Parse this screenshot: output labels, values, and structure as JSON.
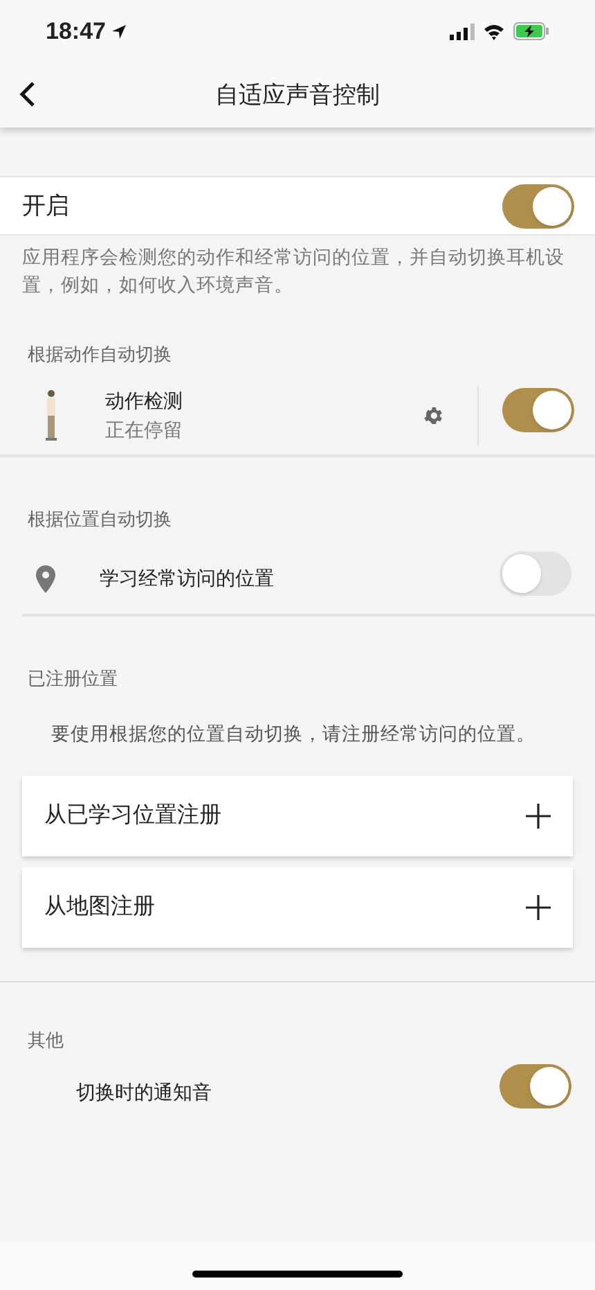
{
  "status_bar": {
    "time": "18:47"
  },
  "nav": {
    "title": "自适应声音控制"
  },
  "master": {
    "label": "开启",
    "on": true
  },
  "description": "应用程序会检测您的动作和经常访问的位置，并自动切换耳机设置，例如，如何收入环境声音。",
  "motion": {
    "heading": "根据动作自动切换",
    "title": "动作检测",
    "subtitle": "正在停留",
    "on": true
  },
  "location": {
    "heading": "根据位置自动切换",
    "label": "学习经常访问的位置",
    "on": false
  },
  "registered": {
    "heading": "已注册位置",
    "hint": "要使用根据您的位置自动切换，请注册经常访问的位置。",
    "actions": [
      {
        "label": "从已学习位置注册"
      },
      {
        "label": "从地图注册"
      }
    ]
  },
  "other": {
    "heading": "其他",
    "label": "切换时的通知音",
    "on": true
  }
}
